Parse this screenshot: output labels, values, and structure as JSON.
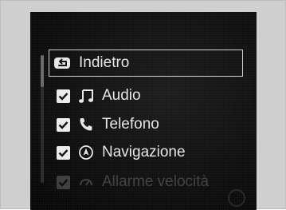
{
  "menu": {
    "back": {
      "label": "Indietro",
      "icon": "back-arrow-icon"
    },
    "items": [
      {
        "label": "Audio",
        "checked": true,
        "icon": "music-note-icon"
      },
      {
        "label": "Telefono",
        "checked": true,
        "icon": "phone-icon"
      },
      {
        "label": "Navigazione",
        "checked": true,
        "icon": "navigation-icon"
      },
      {
        "label": "Allarme velocità",
        "checked": true,
        "icon": "speed-alarm-icon"
      }
    ]
  },
  "colors": {
    "screen_bg": "#111111",
    "text": "#e6e6e6",
    "checkbox": "#ececec",
    "frame": "#cfcfcf"
  }
}
